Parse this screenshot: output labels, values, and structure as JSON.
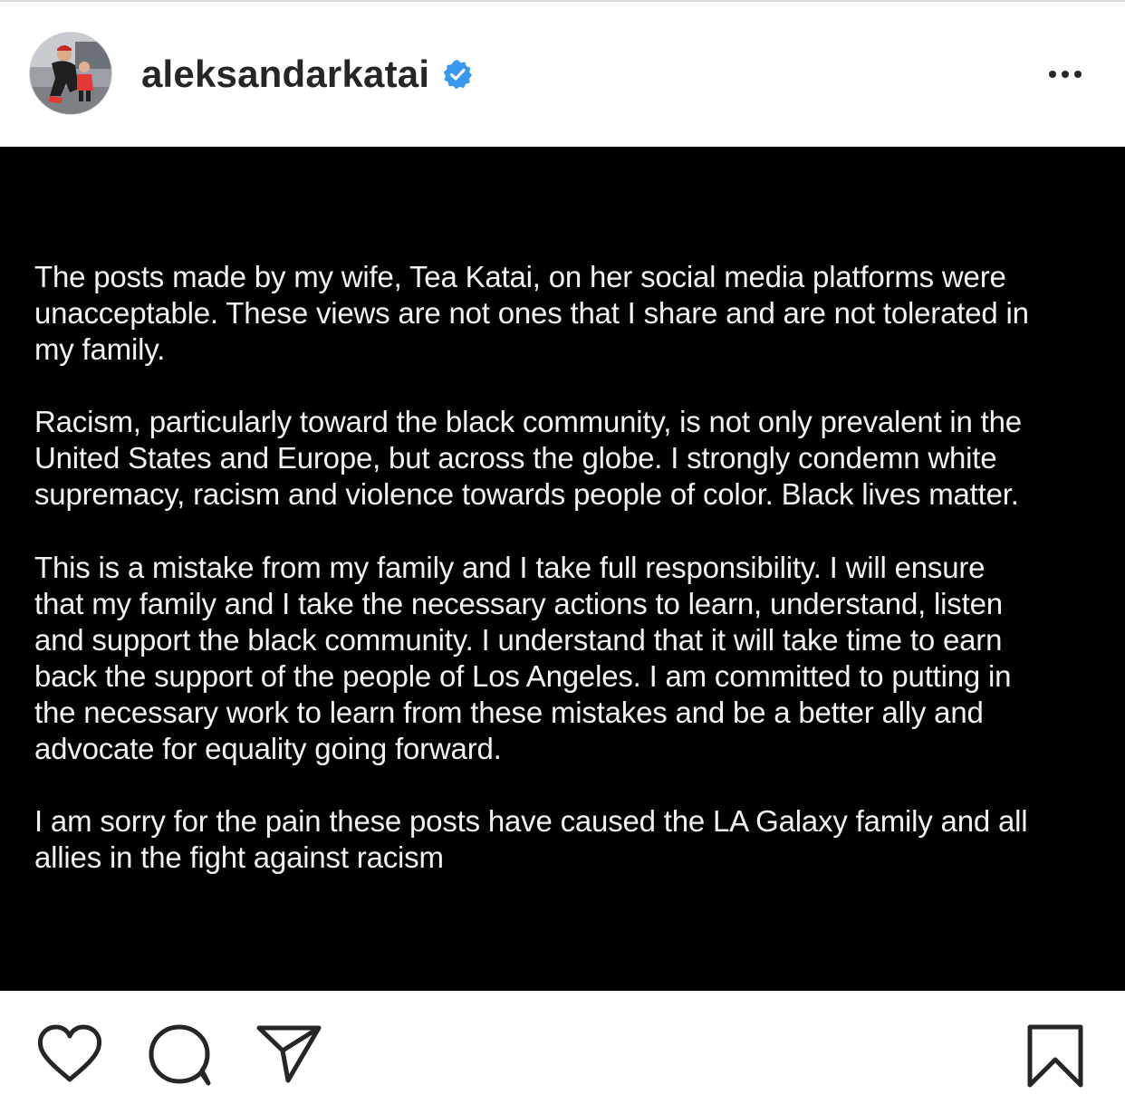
{
  "header": {
    "username": "aleksandarkatai",
    "verified_icon": "verified-badge-icon",
    "more_icon": "more-options-icon",
    "accent_color": "#3897f0"
  },
  "post": {
    "background_color": "#000000",
    "text_color": "#f2f2f2",
    "paragraphs": [
      "The posts made by my wife, Tea Katai, on her social media platforms were\nunacceptable. These views are not ones that I share and are not tolerated in\nmy family.",
      "Racism, particularly toward the black community, is not only prevalent in the\nUnited States and Europe, but across the globe. I strongly condemn white\nsupremacy, racism and violence towards people of color. Black lives matter.",
      "This is a mistake from my family and I take full responsibility. I will ensure\nthat my family and I take the necessary actions to learn, understand, listen\nand support the black community. I understand that it will take time to earn\nback the support of the people of Los Angeles. I am committed to putting in\nthe necessary work to learn from these mistakes and be a better ally and\nadvocate for equality going forward.",
      "I am sorry for the pain these posts have caused the LA Galaxy family and all\nallies in the fight against racism"
    ]
  },
  "actions": {
    "icons": [
      "heart-icon",
      "comment-icon",
      "share-icon",
      "bookmark-icon"
    ]
  }
}
